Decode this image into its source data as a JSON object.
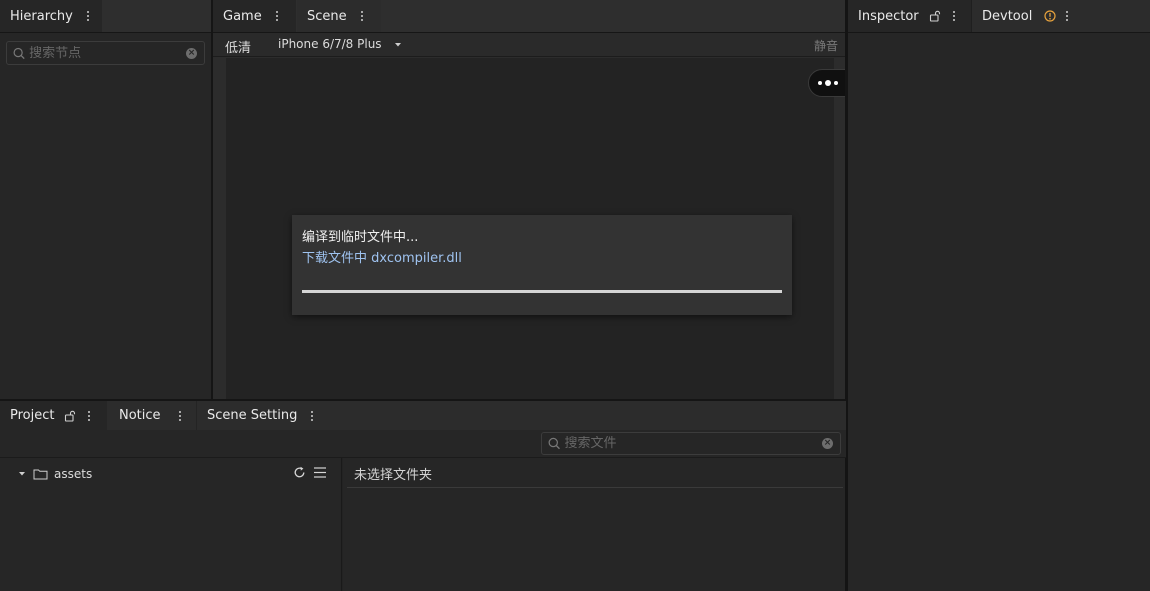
{
  "hierarchy": {
    "tab_label": "Hierarchy",
    "search_placeholder": "搜索节点"
  },
  "center_tabs": {
    "game": "Game",
    "scene": "Scene"
  },
  "game_toolbar": {
    "quality": "低清",
    "device": "iPhone 6/7/8 Plus",
    "mute": "静音"
  },
  "capsule": {
    "more_icon": "more-dots-icon",
    "record_icon": "record-icon"
  },
  "loading_dialog": {
    "title": "编译到临时文件中...",
    "status": "下载文件中 dxcompiler.dll",
    "progress": 1.0
  },
  "right_tabs": {
    "inspector": "Inspector",
    "devtool": "Devtool",
    "warning_color": "#e8a33d"
  },
  "bottom_tabs": {
    "project": "Project",
    "notice": "Notice",
    "scene_setting": "Scene Setting"
  },
  "project": {
    "search_placeholder": "搜索文件",
    "tree": [
      {
        "label": "assets",
        "icon": "folder-icon",
        "expanded": true
      }
    ],
    "empty_message": "未选择文件夹"
  }
}
